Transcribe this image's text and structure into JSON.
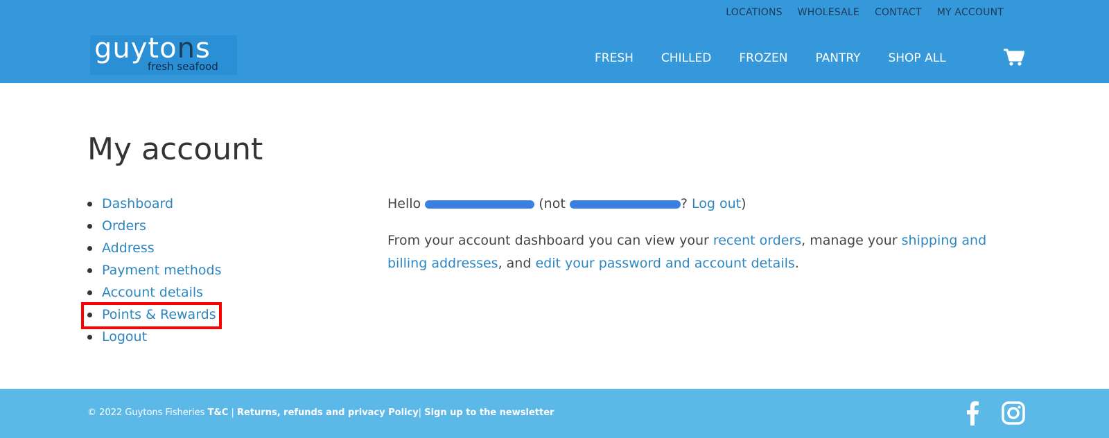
{
  "header": {
    "top_nav": [
      "LOCATIONS",
      "WHOLESALE",
      "CONTACT",
      "MY ACCOUNT"
    ],
    "logo": {
      "main": "guytons",
      "sub": "fresh seafood"
    },
    "main_nav": [
      "FRESH",
      "CHILLED",
      "FROZEN",
      "PANTRY",
      "SHOP ALL"
    ],
    "cart_icon": "cart-icon"
  },
  "page": {
    "title": "My account"
  },
  "account_nav": [
    "Dashboard",
    "Orders",
    "Address",
    "Payment methods",
    "Account details",
    "Points & Rewards",
    "Logout"
  ],
  "content": {
    "hello": "Hello",
    "not_open": "(not",
    "q": "?",
    "logout_link": "Log out",
    "close_paren": ")",
    "dash_intro": "From your account dashboard you can view your",
    "recent_orders": "recent orders",
    "manage": ", manage your",
    "addresses_link": "shipping and billing addresses",
    "and": ", and",
    "edit_link": "edit your password and account details",
    "period": "."
  },
  "footer": {
    "copyright": "© 2022 Guytons Fisheries",
    "tc": "T&C",
    "sep1": "|",
    "returns": "Returns, refunds and privacy Policy",
    "sep2": "|",
    "newsletter": "Sign up to the newsletter"
  },
  "colors": {
    "header_bg": "#3498db",
    "footer_bg": "#5cb8e6",
    "link": "#2e86c1",
    "highlight": "#ff0000"
  }
}
